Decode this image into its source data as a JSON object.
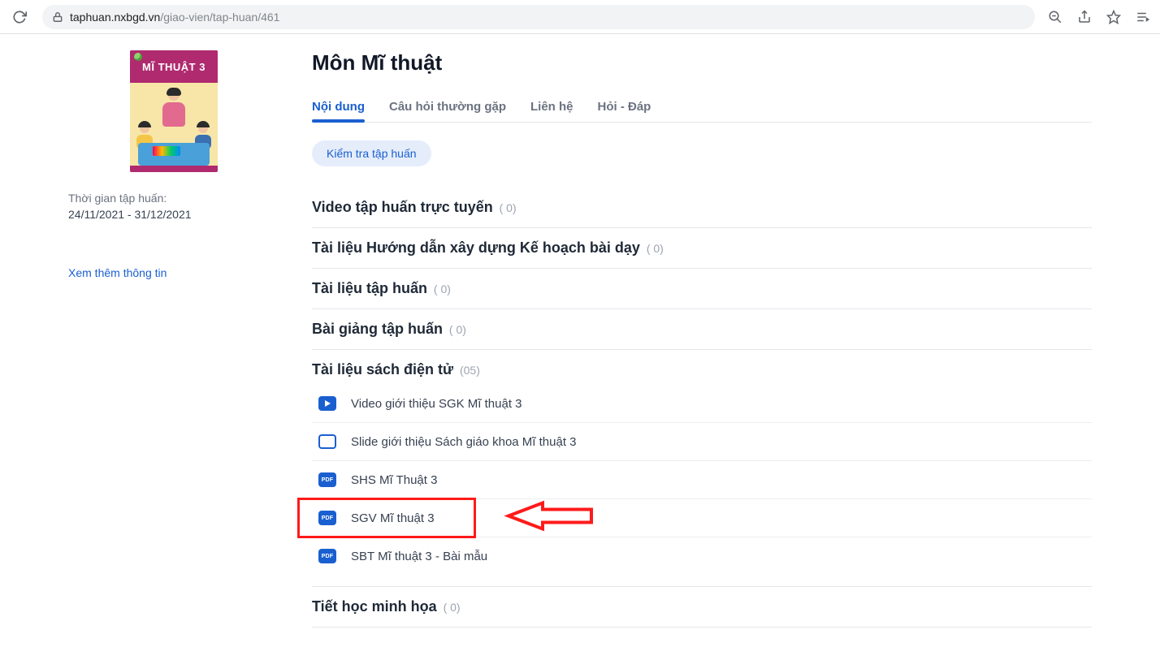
{
  "browser": {
    "url_host": "taphuan.nxbgd.vn",
    "url_path": "/giao-vien/tap-huan/461"
  },
  "sidebar": {
    "cover_title": "MĨ THUẬT 3",
    "time_label": "Thời gian tập huấn:",
    "time_value": "24/11/2021 - 31/12/2021",
    "more_info": "Xem thêm thông tin"
  },
  "main": {
    "title": "Môn Mĩ thuật",
    "tabs": [
      {
        "label": "Nội dung",
        "active": true
      },
      {
        "label": "Câu hỏi thường gặp",
        "active": false
      },
      {
        "label": "Liên hệ",
        "active": false
      },
      {
        "label": "Hỏi - Đáp",
        "active": false
      }
    ],
    "chip": "Kiểm tra tập huấn",
    "sections": [
      {
        "title": "Video tập huấn trực tuyến",
        "count": "( 0)"
      },
      {
        "title": "Tài liệu Hướng dẫn xây dựng Kế hoạch bài dạy",
        "count": "( 0)"
      },
      {
        "title": "Tài liệu tập huấn",
        "count": "( 0)"
      },
      {
        "title": "Bài giảng tập huấn",
        "count": "( 0)"
      },
      {
        "title": "Tài liệu sách điện tử",
        "count": "(05)",
        "items": [
          {
            "type": "video",
            "label": "Video giới thiệu SGK Mĩ thuật 3"
          },
          {
            "type": "slide",
            "label": "Slide giới thiệu Sách giáo khoa Mĩ thuật 3"
          },
          {
            "type": "pdf",
            "label": "SHS Mĩ Thuật 3"
          },
          {
            "type": "pdf",
            "label": "SGV Mĩ thuật 3",
            "highlight": true
          },
          {
            "type": "pdf",
            "label": "SBT Mĩ thuật 3 - Bài mẫu"
          }
        ]
      },
      {
        "title": "Tiết học minh họa",
        "count": "( 0)"
      }
    ]
  }
}
